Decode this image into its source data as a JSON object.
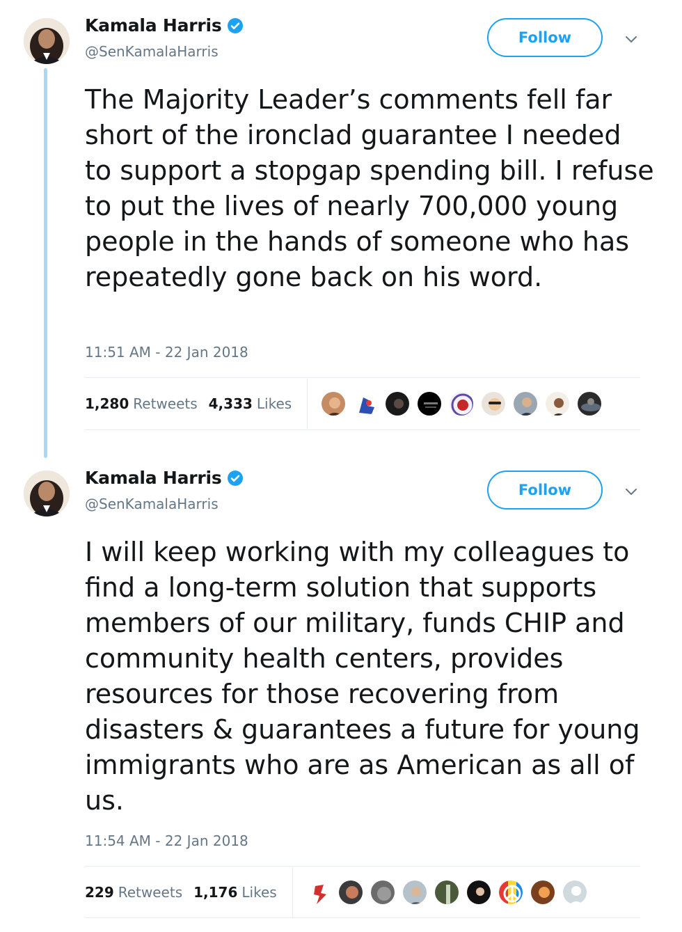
{
  "tweets": [
    {
      "name": "Kamala Harris",
      "handle": "@SenKamalaHarris",
      "follow_label": "Follow",
      "text": "The Majority Leader’s comments fell far short of the ironclad guarantee I needed to support a stopgap spending bill. I refuse to put the lives of nearly 700,000 young people in the hands of someone who has repeatedly gone back on his word.",
      "timestamp": "11:51 AM - 22 Jan 2018",
      "retweets_count": "1,280",
      "retweets_label": "Retweets",
      "likes_count": "4,333",
      "likes_label": "Likes"
    },
    {
      "name": "Kamala Harris",
      "handle": "@SenKamalaHarris",
      "follow_label": "Follow",
      "text": "I will keep working with my colleagues to find a long-term solution that supports members of our military, funds CHIP and community health centers, provides resources for those recovering from disasters & guarantees a future for young immigrants who are as American as all of us.",
      "timestamp": "11:54 AM - 22 Jan 2018",
      "retweets_count": "229",
      "retweets_label": "Retweets",
      "likes_count": "1,176",
      "likes_label": "Likes"
    }
  ],
  "colors": {
    "accent": "#1da1f2",
    "text": "#14171a",
    "muted": "#657786",
    "thread_line": "#a7d8f8",
    "divider": "#e6ecf0"
  },
  "icons": {
    "verified": "verified-badge-icon",
    "caret": "chevron-down-icon"
  }
}
